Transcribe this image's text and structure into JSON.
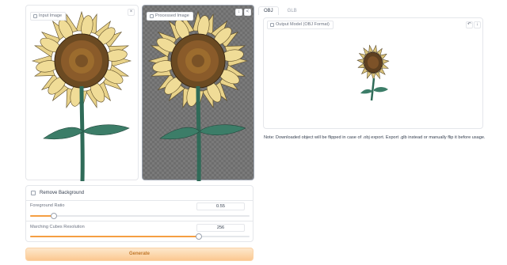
{
  "input_panel": {
    "label": "Input Image",
    "close_icon": "×"
  },
  "processed_panel": {
    "label": "Processed Image",
    "download_icon": "↓",
    "share_icon": "<"
  },
  "tabs": [
    {
      "label": "OBJ",
      "active": true
    },
    {
      "label": "GLB",
      "active": false
    }
  ],
  "output_panel": {
    "label": "Output Model (OBJ Format)",
    "undo_icon": "↶",
    "download_icon": "↓"
  },
  "note": "Note: Downloaded object will be flipped in case of .obj export. Export .glb instead or manually flip it before usage.",
  "remove_background": {
    "label": "Remove Background",
    "checked": false
  },
  "foreground_ratio": {
    "label": "Foreground Ratio",
    "value": "0.55",
    "fraction": 0.11
  },
  "mc_resolution": {
    "label": "Marching Cubes Resolution",
    "value": "256",
    "fraction": 0.77
  },
  "generate_button": {
    "label": "Generate"
  },
  "colors": {
    "accent": "#f59e42",
    "button_text": "#c2782a",
    "button_bg": "#fbc890"
  }
}
